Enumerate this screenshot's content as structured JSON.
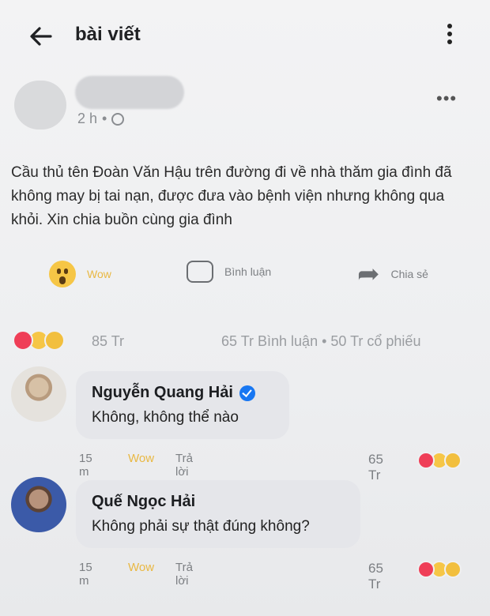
{
  "header": {
    "title": "bài viết"
  },
  "post": {
    "time": "2 h",
    "text": "Cầu thủ tên Đoàn Văn Hậu trên đường đi về nhà thăm gia đình đã không may bị tai nạn, được đưa vào bệnh viện nhưng không qua khỏi. Xin chia buồn cùng gia đình"
  },
  "actions": {
    "like_label": "Wow",
    "comment_label": "Bình luận",
    "share_label": "Chia sẻ"
  },
  "stats": {
    "reactions": "85 Tr",
    "summary": "65 Tr  Bình luận • 50 Tr  cổ phiếu"
  },
  "comments": [
    {
      "name": "Nguyễn Quang Hải",
      "text": "Không, không thể nào",
      "time": "15 m",
      "like_label": "Wow",
      "reply_label": "Trả lời",
      "reaction_count": "65 Tr"
    },
    {
      "name": "Quế Ngọc Hải",
      "text": "Không phải sự thật đúng không?",
      "time": "15 m",
      "like_label": "Wow",
      "reply_label": "Trả lời",
      "reaction_count": "65 Tr"
    }
  ]
}
